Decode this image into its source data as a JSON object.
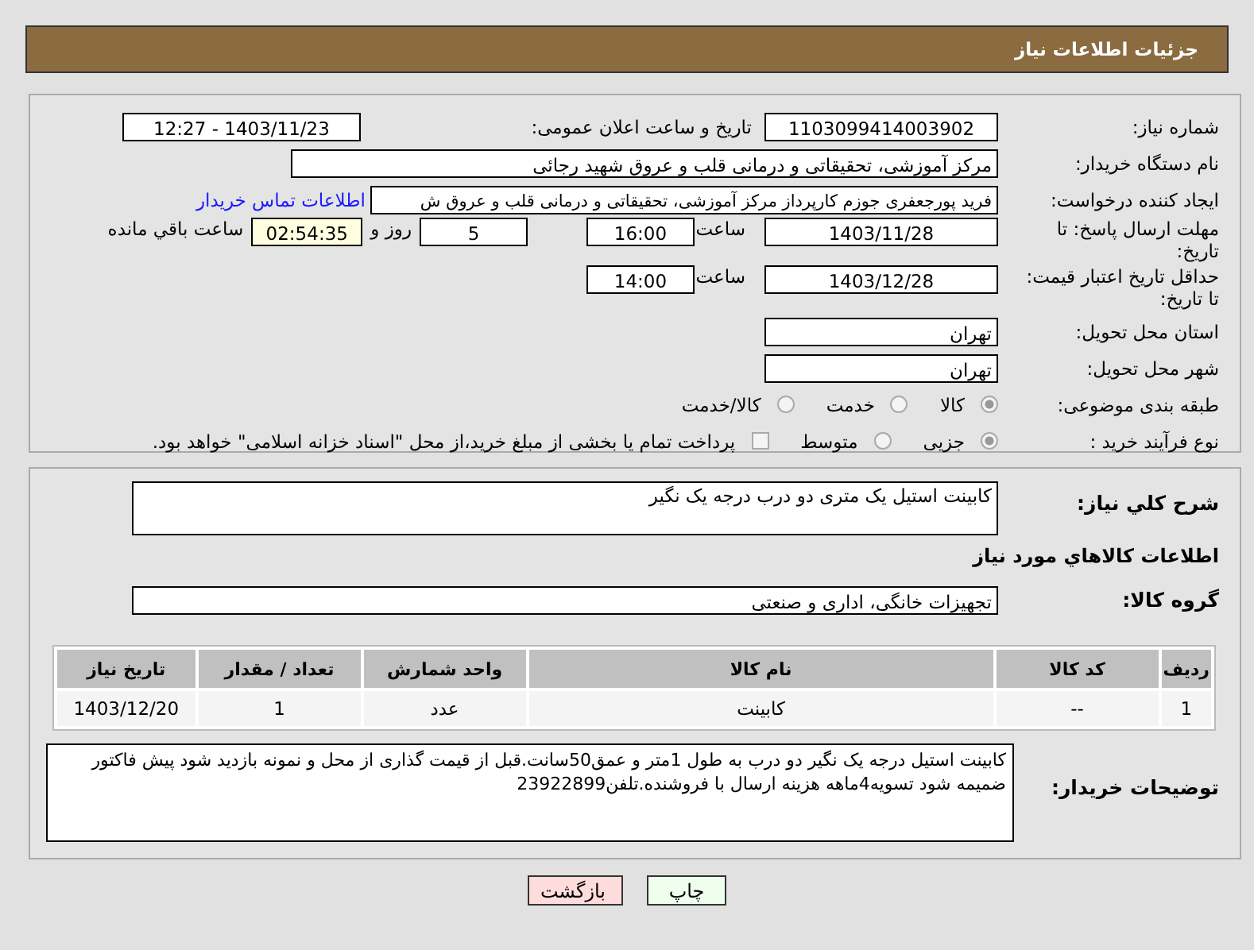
{
  "header": {
    "title": "جزئیات اطلاعات نیاز"
  },
  "need_number": {
    "label": "شماره نیاز:",
    "value": "1103099414003902"
  },
  "announce": {
    "label": "تاریخ و ساعت اعلان عمومی:",
    "value": "1403/11/23 - 12:27"
  },
  "buyer_org": {
    "label": "نام دستگاه خریدار:",
    "value": "مرکز آموزشی، تحقیقاتی و درمانی قلب و عروق شهید رجائی"
  },
  "requester": {
    "label": "ایجاد کننده درخواست:",
    "value": "فرید پورجعفری جوزم کارپرداز  مرکز آموزشی، تحقیقاتی و درمانی قلب و عروق ش",
    "link": "اطلاعات تماس خریدار"
  },
  "reply_deadline": {
    "label": "مهلت ارسال پاسخ: تا تاریخ:",
    "date": "1403/11/28",
    "time_label": "ساعت",
    "time": "16:00",
    "days": "5",
    "days_label": "روز و",
    "remaining": "02:54:35",
    "remaining_label": "ساعت باقي مانده"
  },
  "price_validity": {
    "label": "حداقل تاریخ اعتبار قیمت: تا تاریخ:",
    "date": "1403/12/28",
    "time_label": "ساعت",
    "time": "14:00"
  },
  "province": {
    "label": "استان محل تحویل:",
    "value": "تهران"
  },
  "city": {
    "label": "شهر محل تحویل:",
    "value": "تهران"
  },
  "category": {
    "label": "طبقه بندی موضوعی:",
    "options": [
      {
        "label": "کالا",
        "selected": true
      },
      {
        "label": "خدمت",
        "selected": false
      },
      {
        "label": "کالا/خدمت",
        "selected": false
      }
    ]
  },
  "process": {
    "label": "نوع فرآیند خرید :",
    "options": [
      {
        "label": "جزیی",
        "selected": true
      },
      {
        "label": "متوسط",
        "selected": false
      }
    ],
    "payment": {
      "checked": false,
      "label": "پرداخت تمام یا بخشی از مبلغ خرید،از محل \"اسناد خزانه اسلامی\" خواهد بود."
    }
  },
  "summary": {
    "label": "شرح کلي نياز:",
    "value": "کابینت استیل یک متری دو درب درجه یک نگیر"
  },
  "goods_title": "اطلاعات کالاهاي مورد نياز",
  "goods_group": {
    "label": "گروه کالا:",
    "value": "تجهیزات خانگی، اداری و صنعتی"
  },
  "table": {
    "columns": [
      "رديف",
      "کد کالا",
      "نام کالا",
      "واحد شمارش",
      "تعداد / مقدار",
      "تاریخ نیاز"
    ],
    "rows": [
      [
        "1",
        "--",
        "کابینت",
        "عدد",
        "1",
        "1403/12/20"
      ]
    ]
  },
  "buyer_notes": {
    "label": "توضیحات خریدار:",
    "value": "کابینت استیل درجه یک نگیر دو درب به طول 1متر و عمق50سانت.قبل از قیمت گذاری از محل و نمونه بازدید شود پیش فاکتور ضمیمه شود تسویه4ماهه هزینه ارسال با فروشنده.تلفن23922899"
  },
  "buttons": [
    {
      "label": "چاپ",
      "kind": "print"
    },
    {
      "label": "بازگشت",
      "kind": "back"
    }
  ]
}
